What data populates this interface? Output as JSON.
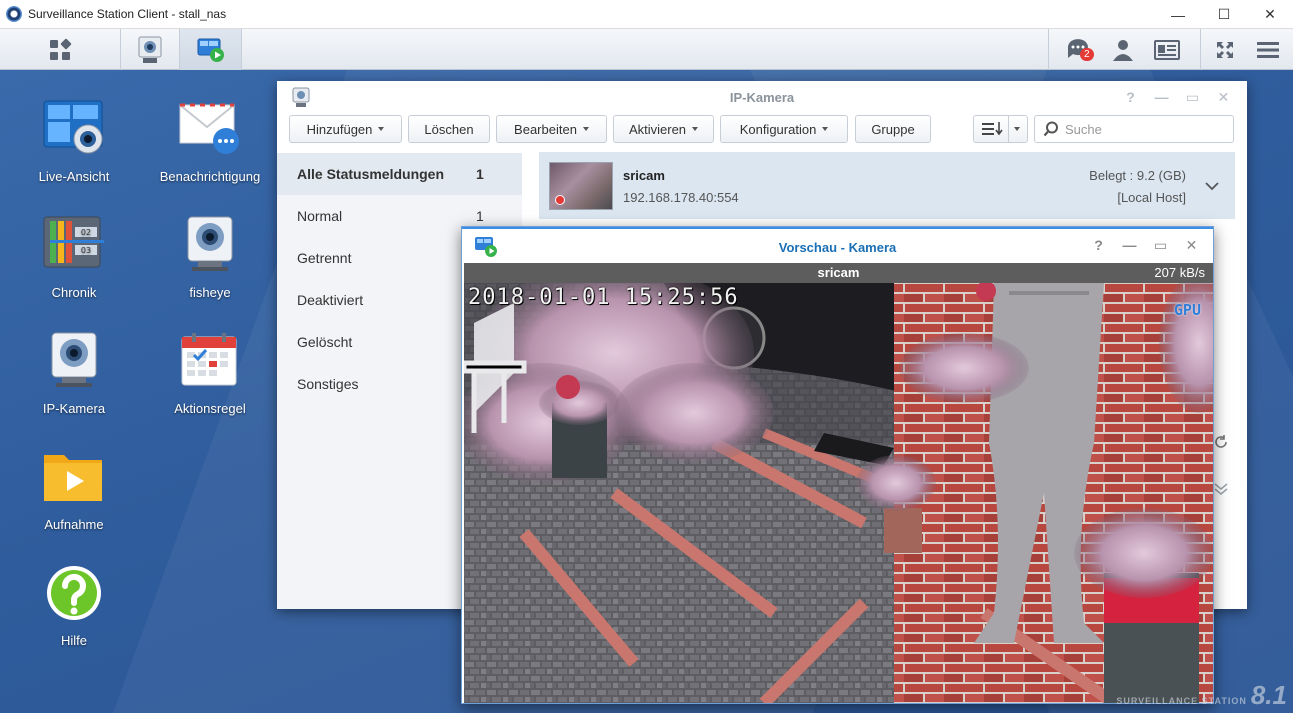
{
  "os_window": {
    "title": "Surveillance Station Client - stall_nas",
    "minimize": "—",
    "maximize": "☐",
    "close": "✕"
  },
  "taskbar": {
    "notification_count": "2"
  },
  "desktop_icons": [
    {
      "label": "Live-Ansicht"
    },
    {
      "label": "Benachrichtigung"
    },
    {
      "label": "Chronik"
    },
    {
      "label": "fisheye"
    },
    {
      "label": "IP-Kamera"
    },
    {
      "label": "Aktionsregel"
    },
    {
      "label": "Aufnahme"
    },
    {
      "label": "Hilfe"
    }
  ],
  "chronik_icon_labels": [
    "02",
    "03"
  ],
  "ip_window": {
    "title": "IP-Kamera",
    "controls": [
      "?",
      "—",
      "▭",
      "✕"
    ],
    "toolbar": {
      "add": "Hinzufügen",
      "delete": "Löschen",
      "edit": "Bearbeiten",
      "activate": "Aktivieren",
      "config": "Konfiguration",
      "group": "Gruppe",
      "search_placeholder": "Suche"
    },
    "sidebar": [
      {
        "label": "Alle Statusmeldungen",
        "count": "1"
      },
      {
        "label": "Normal",
        "count": "1"
      },
      {
        "label": "Getrennt",
        "count": ""
      },
      {
        "label": "Deaktiviert",
        "count": ""
      },
      {
        "label": "Gelöscht",
        "count": ""
      },
      {
        "label": "Sonstiges",
        "count": ""
      }
    ],
    "camera": {
      "name": "sricam",
      "address": "192.168.178.40:554",
      "used": "Belegt : 9.2 (GB)",
      "host": "[Local Host]"
    }
  },
  "preview_window": {
    "title": "Vorschau - Kamera",
    "controls": [
      "?",
      "—",
      "▭",
      "✕"
    ],
    "stream_name": "sricam",
    "bitrate": "207 kB/s",
    "osd_timestamp": "2018-01-01 15:25:56",
    "gpu_label": "GPU"
  },
  "branding": {
    "small": "SURVEILLANCE STATION",
    "version": "8.1"
  },
  "colors": {
    "desktop": "#2f5e9e",
    "preview_title": "#1a6fb5",
    "selected_row": "#dbe6f1",
    "badge": "#e53935"
  }
}
